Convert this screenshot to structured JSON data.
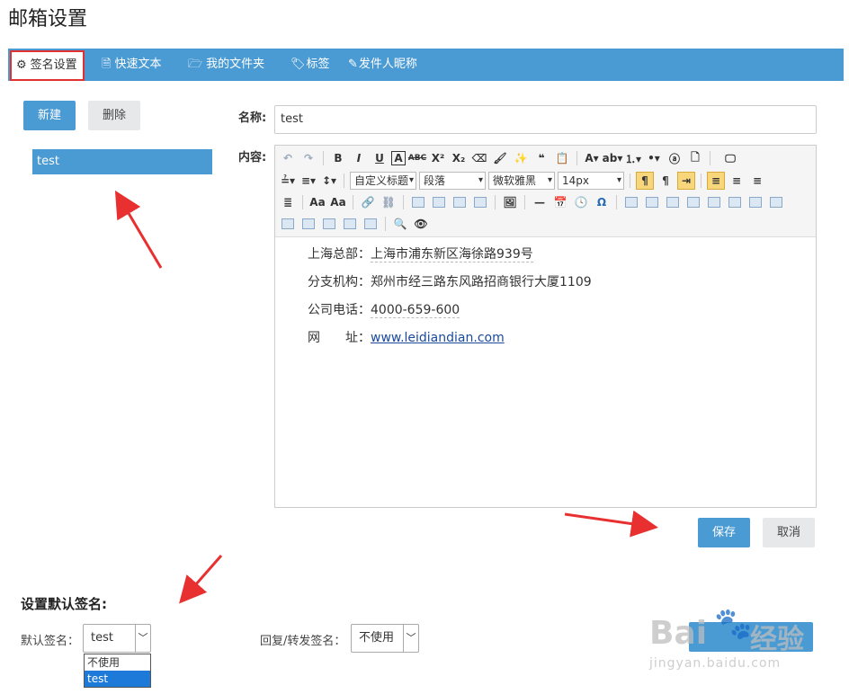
{
  "page": {
    "title": "邮箱设置"
  },
  "tabs": [
    {
      "icon": "gear-icon",
      "label": "签名设置",
      "active": true
    },
    {
      "icon": "document-icon",
      "label": "快速文本"
    },
    {
      "icon": "folder-icon",
      "label": "我的文件夹"
    },
    {
      "icon": "tags-icon",
      "label": "标签"
    },
    {
      "icon": "edit-icon",
      "label": "发件人昵称"
    }
  ],
  "left": {
    "new_label": "新建",
    "delete_label": "删除",
    "signatures": [
      "test"
    ]
  },
  "form": {
    "name_label": "名称:",
    "name_value": "test",
    "content_label": "内容:",
    "toolbar": {
      "custom_title": "自定义标题",
      "paragraph": "段落",
      "font": "微软雅黑",
      "font_size": "14px"
    },
    "content": [
      {
        "label": "上海总部：",
        "value": "上海市浦东新区海徐路939号"
      },
      {
        "label": "分支机构：",
        "value": "郑州市经三路东风路招商银行大厦1109"
      },
      {
        "label": "公司电话：",
        "value": "4000-659-600"
      },
      {
        "label": "网　　址：",
        "value": "www.leidiandian.com"
      }
    ],
    "save_label": "保存",
    "cancel_label": "取消"
  },
  "defaults": {
    "section_title": "设置默认签名:",
    "default_label": "默认签名：",
    "default_value": "test",
    "default_options": [
      "不使用",
      "test"
    ],
    "reply_label": "回复/转发签名：",
    "reply_value": "不使用"
  },
  "watermark": {
    "text1": "Bai",
    "text2": "经验",
    "url": "jingyan.baidu.com"
  },
  "colors": {
    "primary": "#4a9ad4",
    "highlight": "#e03030",
    "selected_option": "#1e7ad8"
  }
}
